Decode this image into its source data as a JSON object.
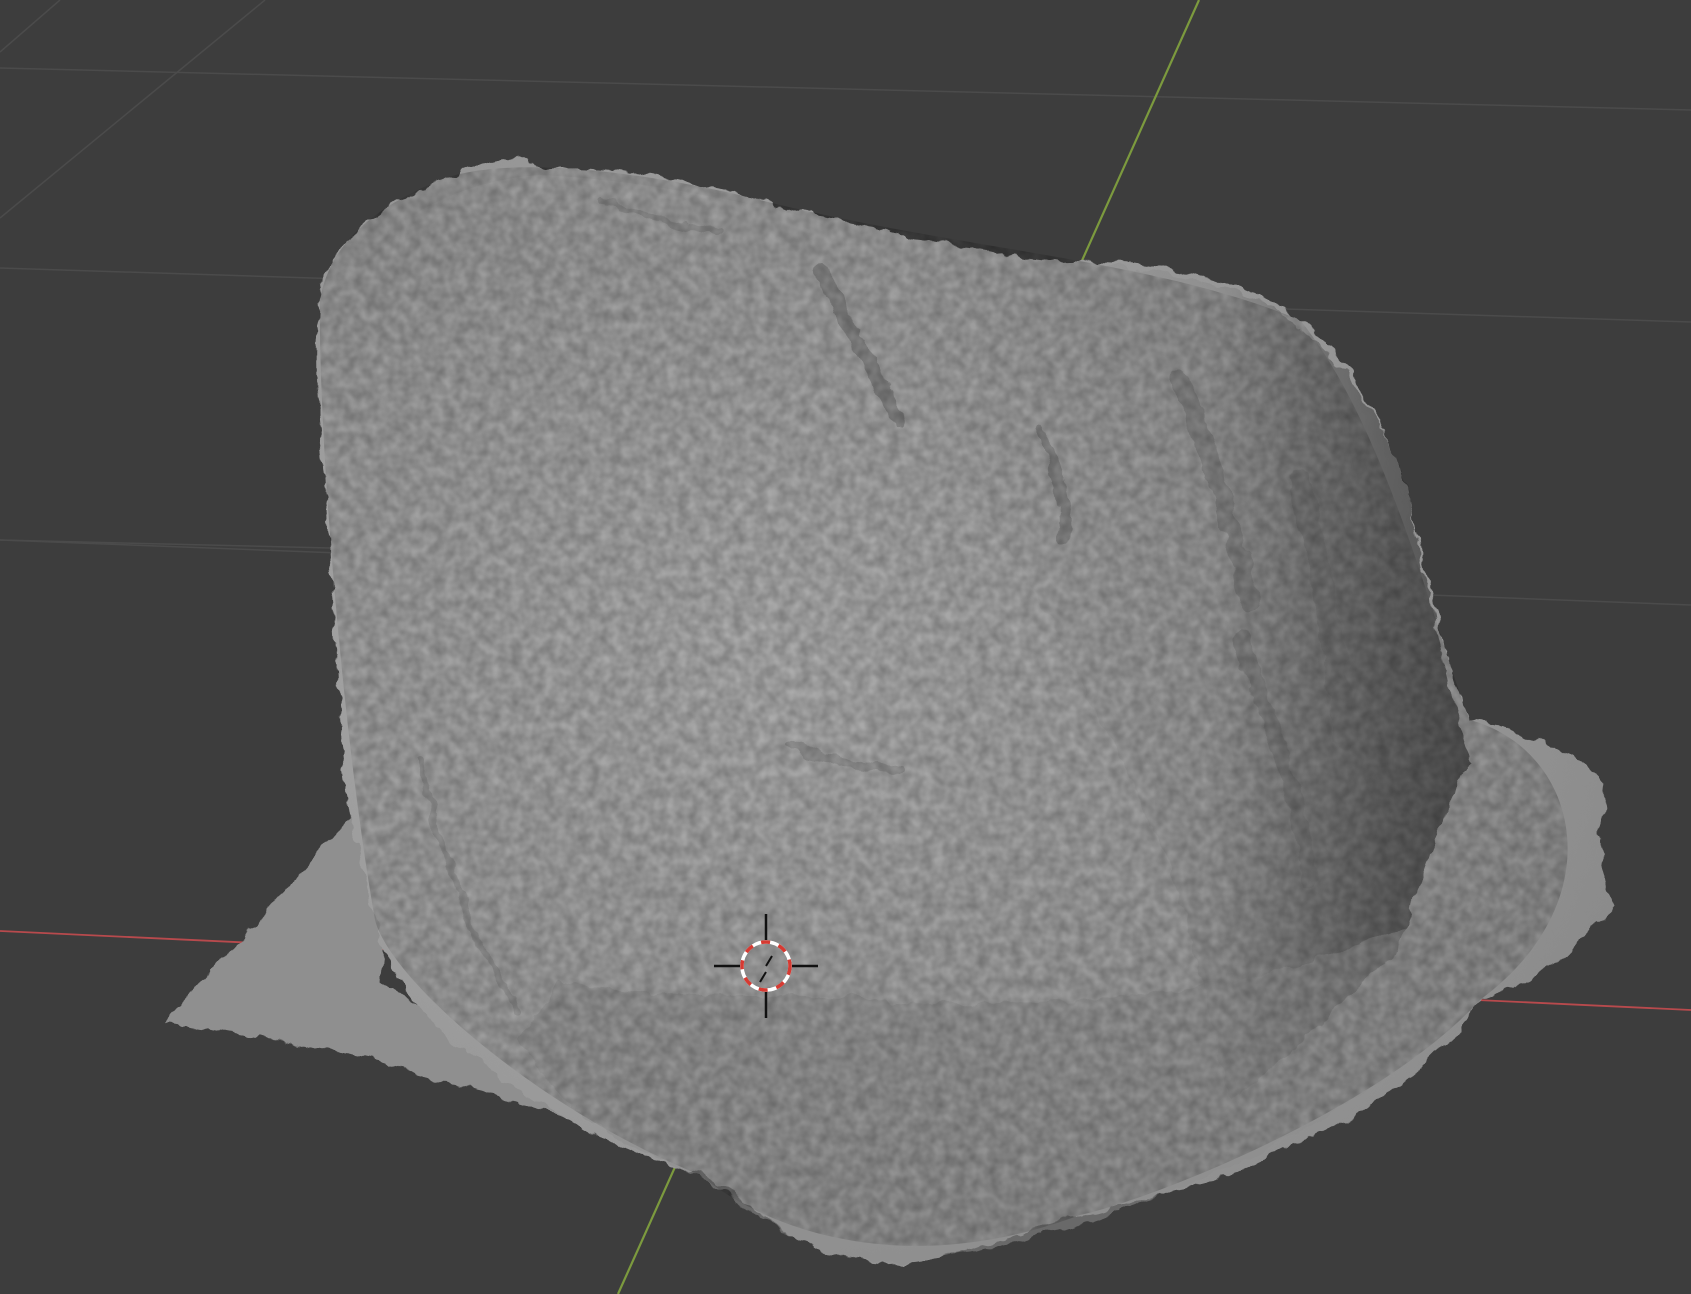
{
  "viewport": {
    "background": "#3d3d3d",
    "grid_color": "#4b4b4b",
    "x_axis_color": "#b84a4d",
    "y_axis_color": "#7c9a3e",
    "object_base_color": "#9c9c9c",
    "object_shadow_color": "#5e5e5e",
    "object_highlight_color": "#b1b1b1",
    "cursor_ring_colors": [
      "#d63a32",
      "#ffffff"
    ],
    "cursor_crosshair_color": "#111111"
  },
  "icons": {
    "cursor": "3d-cursor-icon"
  }
}
